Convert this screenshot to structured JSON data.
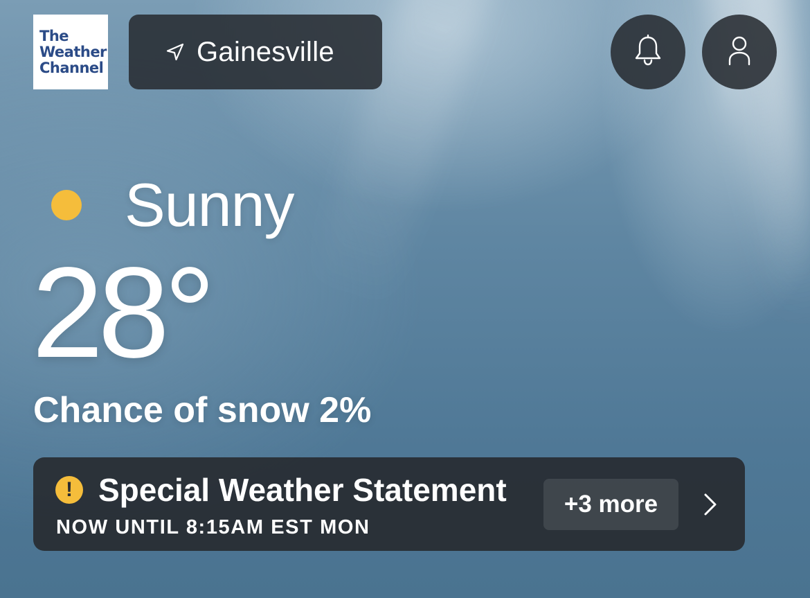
{
  "logo": {
    "lines": [
      "The",
      "Weather",
      "Channel"
    ]
  },
  "location": {
    "icon": "location-arrow-icon",
    "name": "Gainesville"
  },
  "header_buttons": {
    "notifications_icon": "bell-icon",
    "account_icon": "user-icon"
  },
  "current": {
    "condition_icon": "sun-icon",
    "condition_color": "#f5bd3b",
    "condition": "Sunny",
    "temperature": "28°",
    "precip": "Chance of snow 2%"
  },
  "alert": {
    "icon": "exclamation-icon",
    "icon_color": "#f5bd3b",
    "title": "Special Weather Statement",
    "time": "NOW UNTIL 8:15AM EST MON",
    "more_label": "+3 more",
    "chevron_icon": "chevron-right-icon"
  }
}
